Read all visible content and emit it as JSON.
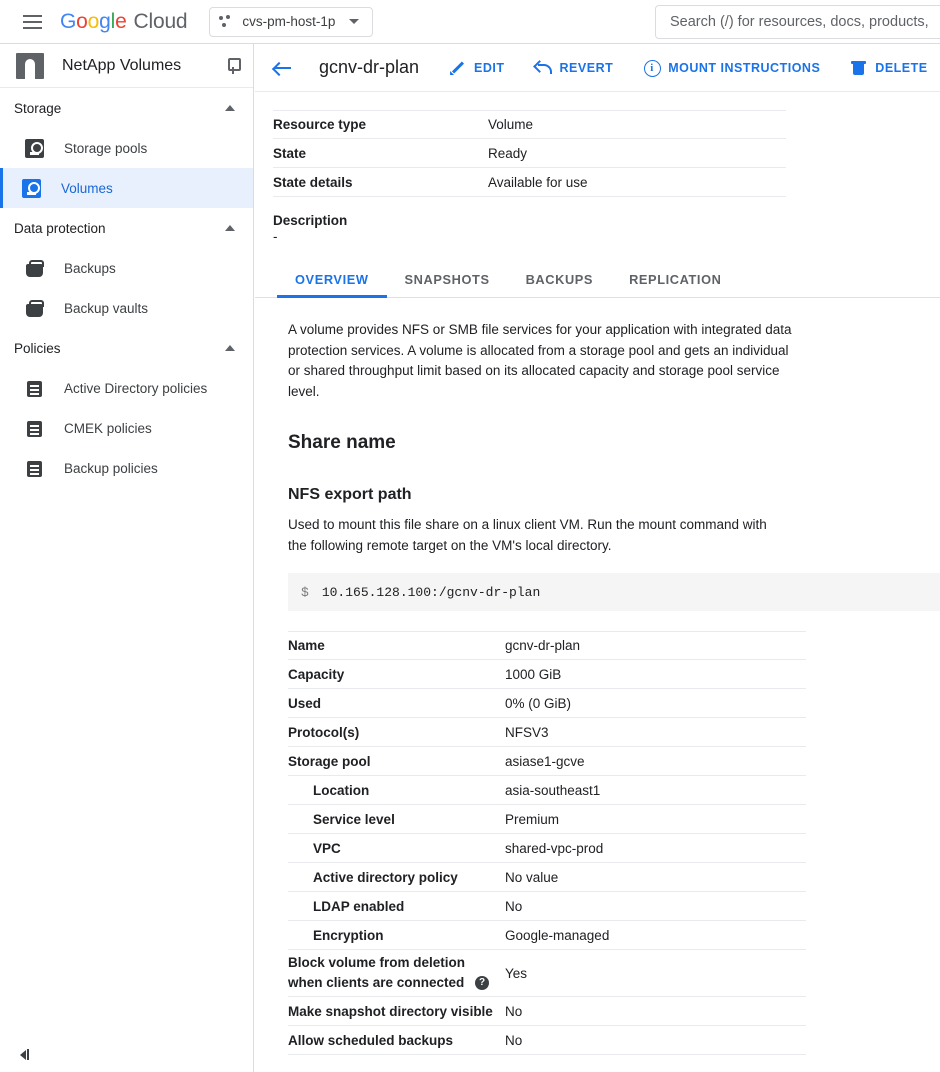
{
  "topbar": {
    "logo": {
      "text": "Google Cloud",
      "letters": [
        "G",
        "o",
        "o",
        "g",
        "l",
        "e"
      ],
      "cloud": "Cloud"
    },
    "project": {
      "name": "cvs-pm-host-1p",
      "icon": "project-dots-icon"
    },
    "search": {
      "placeholder": "Search (/) for resources, docs, products,",
      "value": ""
    },
    "menu_icon": "hamburger-menu-icon"
  },
  "sidebar": {
    "product_title": "NetApp Volumes",
    "pin_icon": "pin-icon",
    "collapse_label": "<|",
    "groups": [
      {
        "label": "Storage",
        "items": [
          {
            "label": "Storage pools",
            "icon": "storage-pool-icon",
            "active": false
          },
          {
            "label": "Volumes",
            "icon": "volume-icon",
            "active": true
          }
        ]
      },
      {
        "label": "Data protection",
        "items": [
          {
            "label": "Backups",
            "icon": "backup-icon",
            "active": false
          },
          {
            "label": "Backup vaults",
            "icon": "backup-vault-icon",
            "active": false
          }
        ]
      },
      {
        "label": "Policies",
        "items": [
          {
            "label": "Active Directory policies",
            "icon": "policy-icon",
            "active": false
          },
          {
            "label": "CMEK policies",
            "icon": "policy-icon",
            "active": false
          },
          {
            "label": "Backup policies",
            "icon": "policy-icon",
            "active": false
          }
        ]
      }
    ]
  },
  "page": {
    "back_icon": "back-arrow-icon",
    "title": "gcnv-dr-plan",
    "toolbar": [
      {
        "label": "EDIT",
        "icon": "pencil-icon"
      },
      {
        "label": "REVERT",
        "icon": "undo-icon"
      },
      {
        "label": "MOUNT INSTRUCTIONS",
        "icon": "info-circle-icon"
      },
      {
        "label": "DELETE",
        "icon": "trash-icon"
      }
    ]
  },
  "info_table": [
    {
      "key": "Resource type",
      "value": "Volume"
    },
    {
      "key": "State",
      "value": "Ready"
    },
    {
      "key": "State details",
      "value": "Available for use"
    }
  ],
  "description": {
    "label": "Description",
    "value": "-"
  },
  "tabs": [
    {
      "label": "OVERVIEW",
      "active": true
    },
    {
      "label": "SNAPSHOTS",
      "active": false
    },
    {
      "label": "BACKUPS",
      "active": false
    },
    {
      "label": "REPLICATION",
      "active": false
    }
  ],
  "overview": {
    "intro": "A volume provides NFS or SMB file services for your application with integrated data protection services. A volume is allocated from a storage pool and gets an individual or shared throughput limit based on its allocated capacity and storage pool service level.",
    "share_name_heading": "Share name",
    "nfs_heading": "NFS export path",
    "nfs_subtext": "Used to mount this file share on a linux client VM. Run the mount command with the following remote target on the VM's local directory.",
    "code_prompt": "$",
    "code_command": "10.165.128.100:/gcnv-dr-plan"
  },
  "detail_table": [
    {
      "key": "Name",
      "value": "gcnv-dr-plan",
      "sub": false
    },
    {
      "key": "Capacity",
      "value": "1000 GiB",
      "sub": false
    },
    {
      "key": "Used",
      "value": "0% (0 GiB)",
      "sub": false
    },
    {
      "key": "Protocol(s)",
      "value": "NFSV3",
      "sub": false
    },
    {
      "key": "Storage pool",
      "value": "asiase1-gcve",
      "sub": false
    },
    {
      "key": "Location",
      "value": "asia-southeast1",
      "sub": true
    },
    {
      "key": "Service level",
      "value": "Premium",
      "sub": true
    },
    {
      "key": "VPC",
      "value": "shared-vpc-prod",
      "sub": true
    },
    {
      "key": "Active directory policy",
      "value": "No value",
      "sub": true
    },
    {
      "key": "LDAP enabled",
      "value": "No",
      "sub": true
    },
    {
      "key": "Encryption",
      "value": "Google-managed",
      "sub": true
    }
  ],
  "detail_table_bottom": [
    {
      "key_line1": "Block volume from deletion",
      "key_line2": "when clients are connected",
      "help_icon": "help-circle-icon",
      "value": "Yes",
      "tall": true
    },
    {
      "key_line1": "Make snapshot directory visible",
      "value": "No",
      "tall": false
    },
    {
      "key_line1": "Allow scheduled backups",
      "value": "No",
      "tall": false
    }
  ],
  "colors": {
    "accent": "#1a73e8",
    "accent_bg": "#e8f0fe",
    "border": "#e8eaed",
    "text": "#202124",
    "muted": "#5f6368",
    "code_bg": "#f5f5f5"
  }
}
